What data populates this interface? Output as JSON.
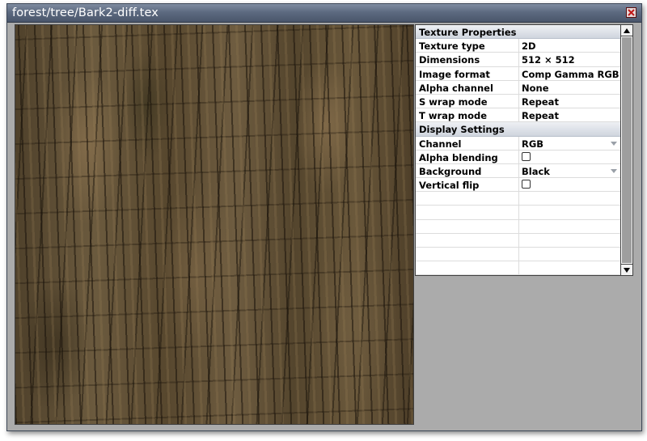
{
  "window": {
    "title": "forest/tree/Bark2-diff.tex"
  },
  "properties": {
    "sections": [
      {
        "title": "Texture Properties",
        "rows": [
          {
            "label": "Texture type",
            "value": "2D"
          },
          {
            "label": "Dimensions",
            "value": "512 × 512"
          },
          {
            "label": "Image format",
            "value": "Comp Gamma RGB"
          },
          {
            "label": "Alpha channel",
            "value": "None"
          },
          {
            "label": "S wrap mode",
            "value": "Repeat"
          },
          {
            "label": "T wrap mode",
            "value": "Repeat"
          }
        ]
      },
      {
        "title": "Display Settings",
        "rows": [
          {
            "label": "Channel",
            "value": "RGB"
          },
          {
            "label": "Alpha blending",
            "value": false
          },
          {
            "label": "Background",
            "value": "Black"
          },
          {
            "label": "Vertical flip",
            "value": false
          }
        ]
      }
    ]
  },
  "colors": {
    "window_bg": "#ababab",
    "titlebar": "#5d6a80",
    "close_x": "#c01818"
  },
  "icons": {
    "close": "close-icon",
    "scroll_up": "arrow-up-icon",
    "scroll_down": "arrow-down-icon",
    "dropdown": "chevron-down-icon"
  }
}
